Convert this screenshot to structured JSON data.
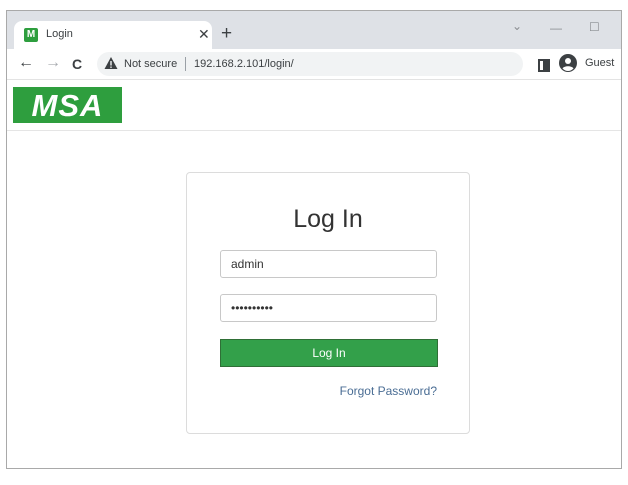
{
  "browser": {
    "tab": {
      "favicon_letter": "M",
      "title": "Login"
    },
    "tab_close": "✕",
    "new_tab": "+",
    "window_controls": {
      "dropdown": "⌄",
      "minimize": "—",
      "maximize": "☐"
    },
    "nav": {
      "back": "←",
      "forward": "→",
      "reload": "C"
    },
    "omnibox": {
      "security_label": "Not secure",
      "url": "192.168.2.101/login/"
    },
    "profile_label": "Guest"
  },
  "site": {
    "logo_text": "MSA",
    "brand_color": "#2e9e3e"
  },
  "login": {
    "title": "Log In",
    "username_value": "admin",
    "password_value": "••••••••••",
    "submit_label": "Log In",
    "forgot_label": "Forgot Password?"
  }
}
